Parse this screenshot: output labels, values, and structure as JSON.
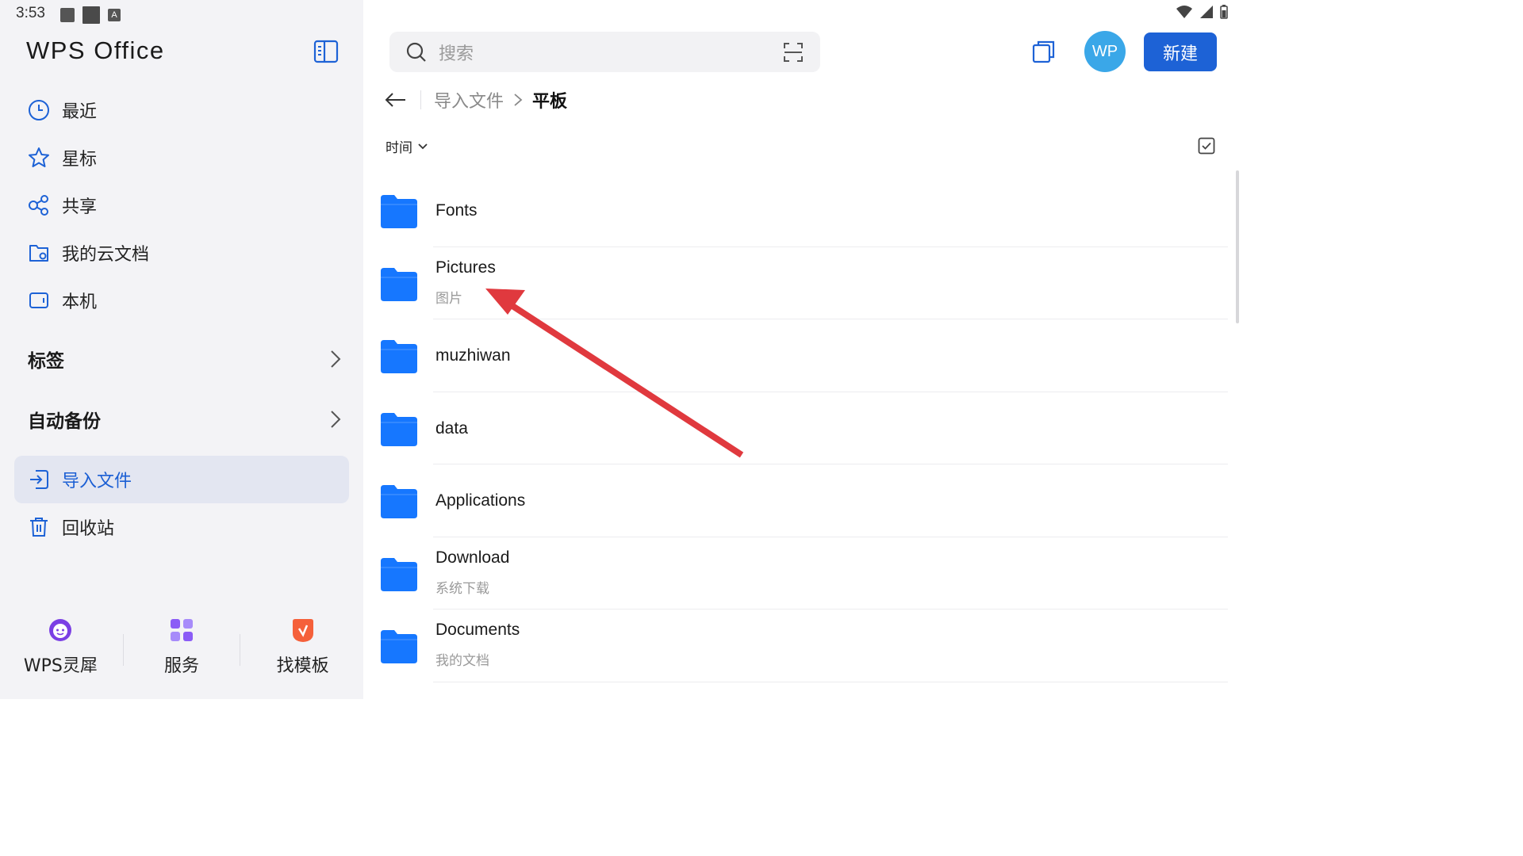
{
  "status": {
    "time": "3:53"
  },
  "app": {
    "logo": "WPS Office"
  },
  "sidebar": {
    "nav": [
      {
        "label": "最近",
        "icon": "clock-icon"
      },
      {
        "label": "星标",
        "icon": "star-icon"
      },
      {
        "label": "共享",
        "icon": "share-icon"
      },
      {
        "label": "我的云文档",
        "icon": "cloud-folder-icon"
      },
      {
        "label": "本机",
        "icon": "device-icon"
      }
    ],
    "sections": [
      {
        "label": "标签"
      },
      {
        "label": "自动备份"
      }
    ],
    "nav2": [
      {
        "label": "导入文件",
        "icon": "import-icon",
        "active": true
      },
      {
        "label": "回收站",
        "icon": "trash-icon"
      }
    ],
    "bottom": [
      {
        "label": "WPS灵犀",
        "icon": "lingxi-icon"
      },
      {
        "label": "服务",
        "icon": "apps-grid-icon"
      },
      {
        "label": "找模板",
        "icon": "template-icon"
      }
    ]
  },
  "header": {
    "search_placeholder": "搜索",
    "avatar": "WP",
    "new_button": "新建"
  },
  "breadcrumb": {
    "parent": "导入文件",
    "current": "平板"
  },
  "sort": {
    "label": "时间"
  },
  "files": [
    {
      "name": "Fonts",
      "subtitle": ""
    },
    {
      "name": "Pictures",
      "subtitle": "图片"
    },
    {
      "name": "muzhiwan",
      "subtitle": ""
    },
    {
      "name": "data",
      "subtitle": ""
    },
    {
      "name": "Applications",
      "subtitle": ""
    },
    {
      "name": "Download",
      "subtitle": "系统下载"
    },
    {
      "name": "Documents",
      "subtitle": "我的文档"
    }
  ],
  "colors": {
    "accent": "#1d62d6",
    "folder": "#1677ff",
    "annotation_arrow": "#e0393e",
    "sidebar_bg": "#f3f3f6"
  }
}
